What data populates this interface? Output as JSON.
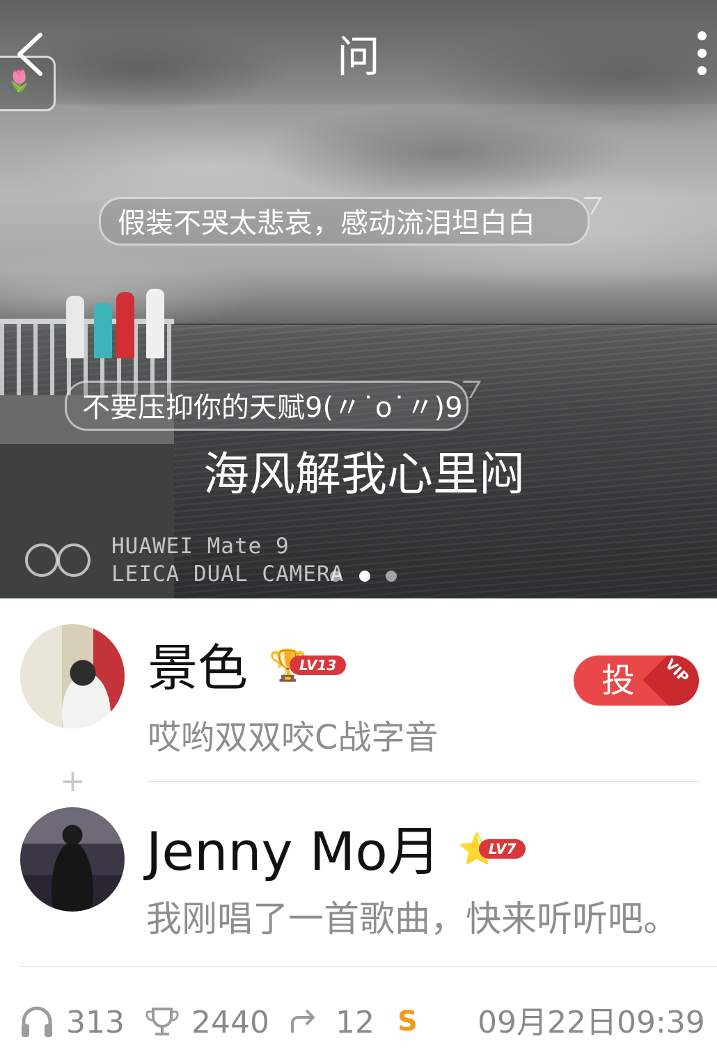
{
  "header": {
    "title": "问",
    "back_icon": "chevron-left-icon",
    "more_icon": "more-vertical-icon"
  },
  "hero": {
    "bubbles": [
      "假装不哭太悲哀，感动流泪坦白白",
      "不要压抑你的天赋9(〃˙o˙〃)9"
    ],
    "caption": "海风解我心里闷",
    "watermark": {
      "line1": "HUAWEI Mate 9",
      "line2": "LEICA DUAL CAMERA"
    },
    "page_indicator": {
      "count": 3,
      "active": 1
    }
  },
  "posts": [
    {
      "username": "景色",
      "level": "LV13",
      "level_icon": "trophy-icon",
      "subtitle": "哎哟双双咬C战字音"
    },
    {
      "username": "Jenny Mo月",
      "level": "LV7",
      "level_icon": "star-icon",
      "subtitle": "我刚唱了一首歌曲，快来听听吧。"
    }
  ],
  "vote_button": {
    "label": "投",
    "corner": "VIP"
  },
  "plus_symbol": "+",
  "stats": {
    "listens": "313",
    "trophies": "2440",
    "shares": "12",
    "s_badge": "S",
    "timestamp": "09月22日09:39"
  },
  "colors": {
    "accent_red": "#e84848",
    "badge_red": "#d9383a",
    "s_orange": "#f29b1b"
  }
}
